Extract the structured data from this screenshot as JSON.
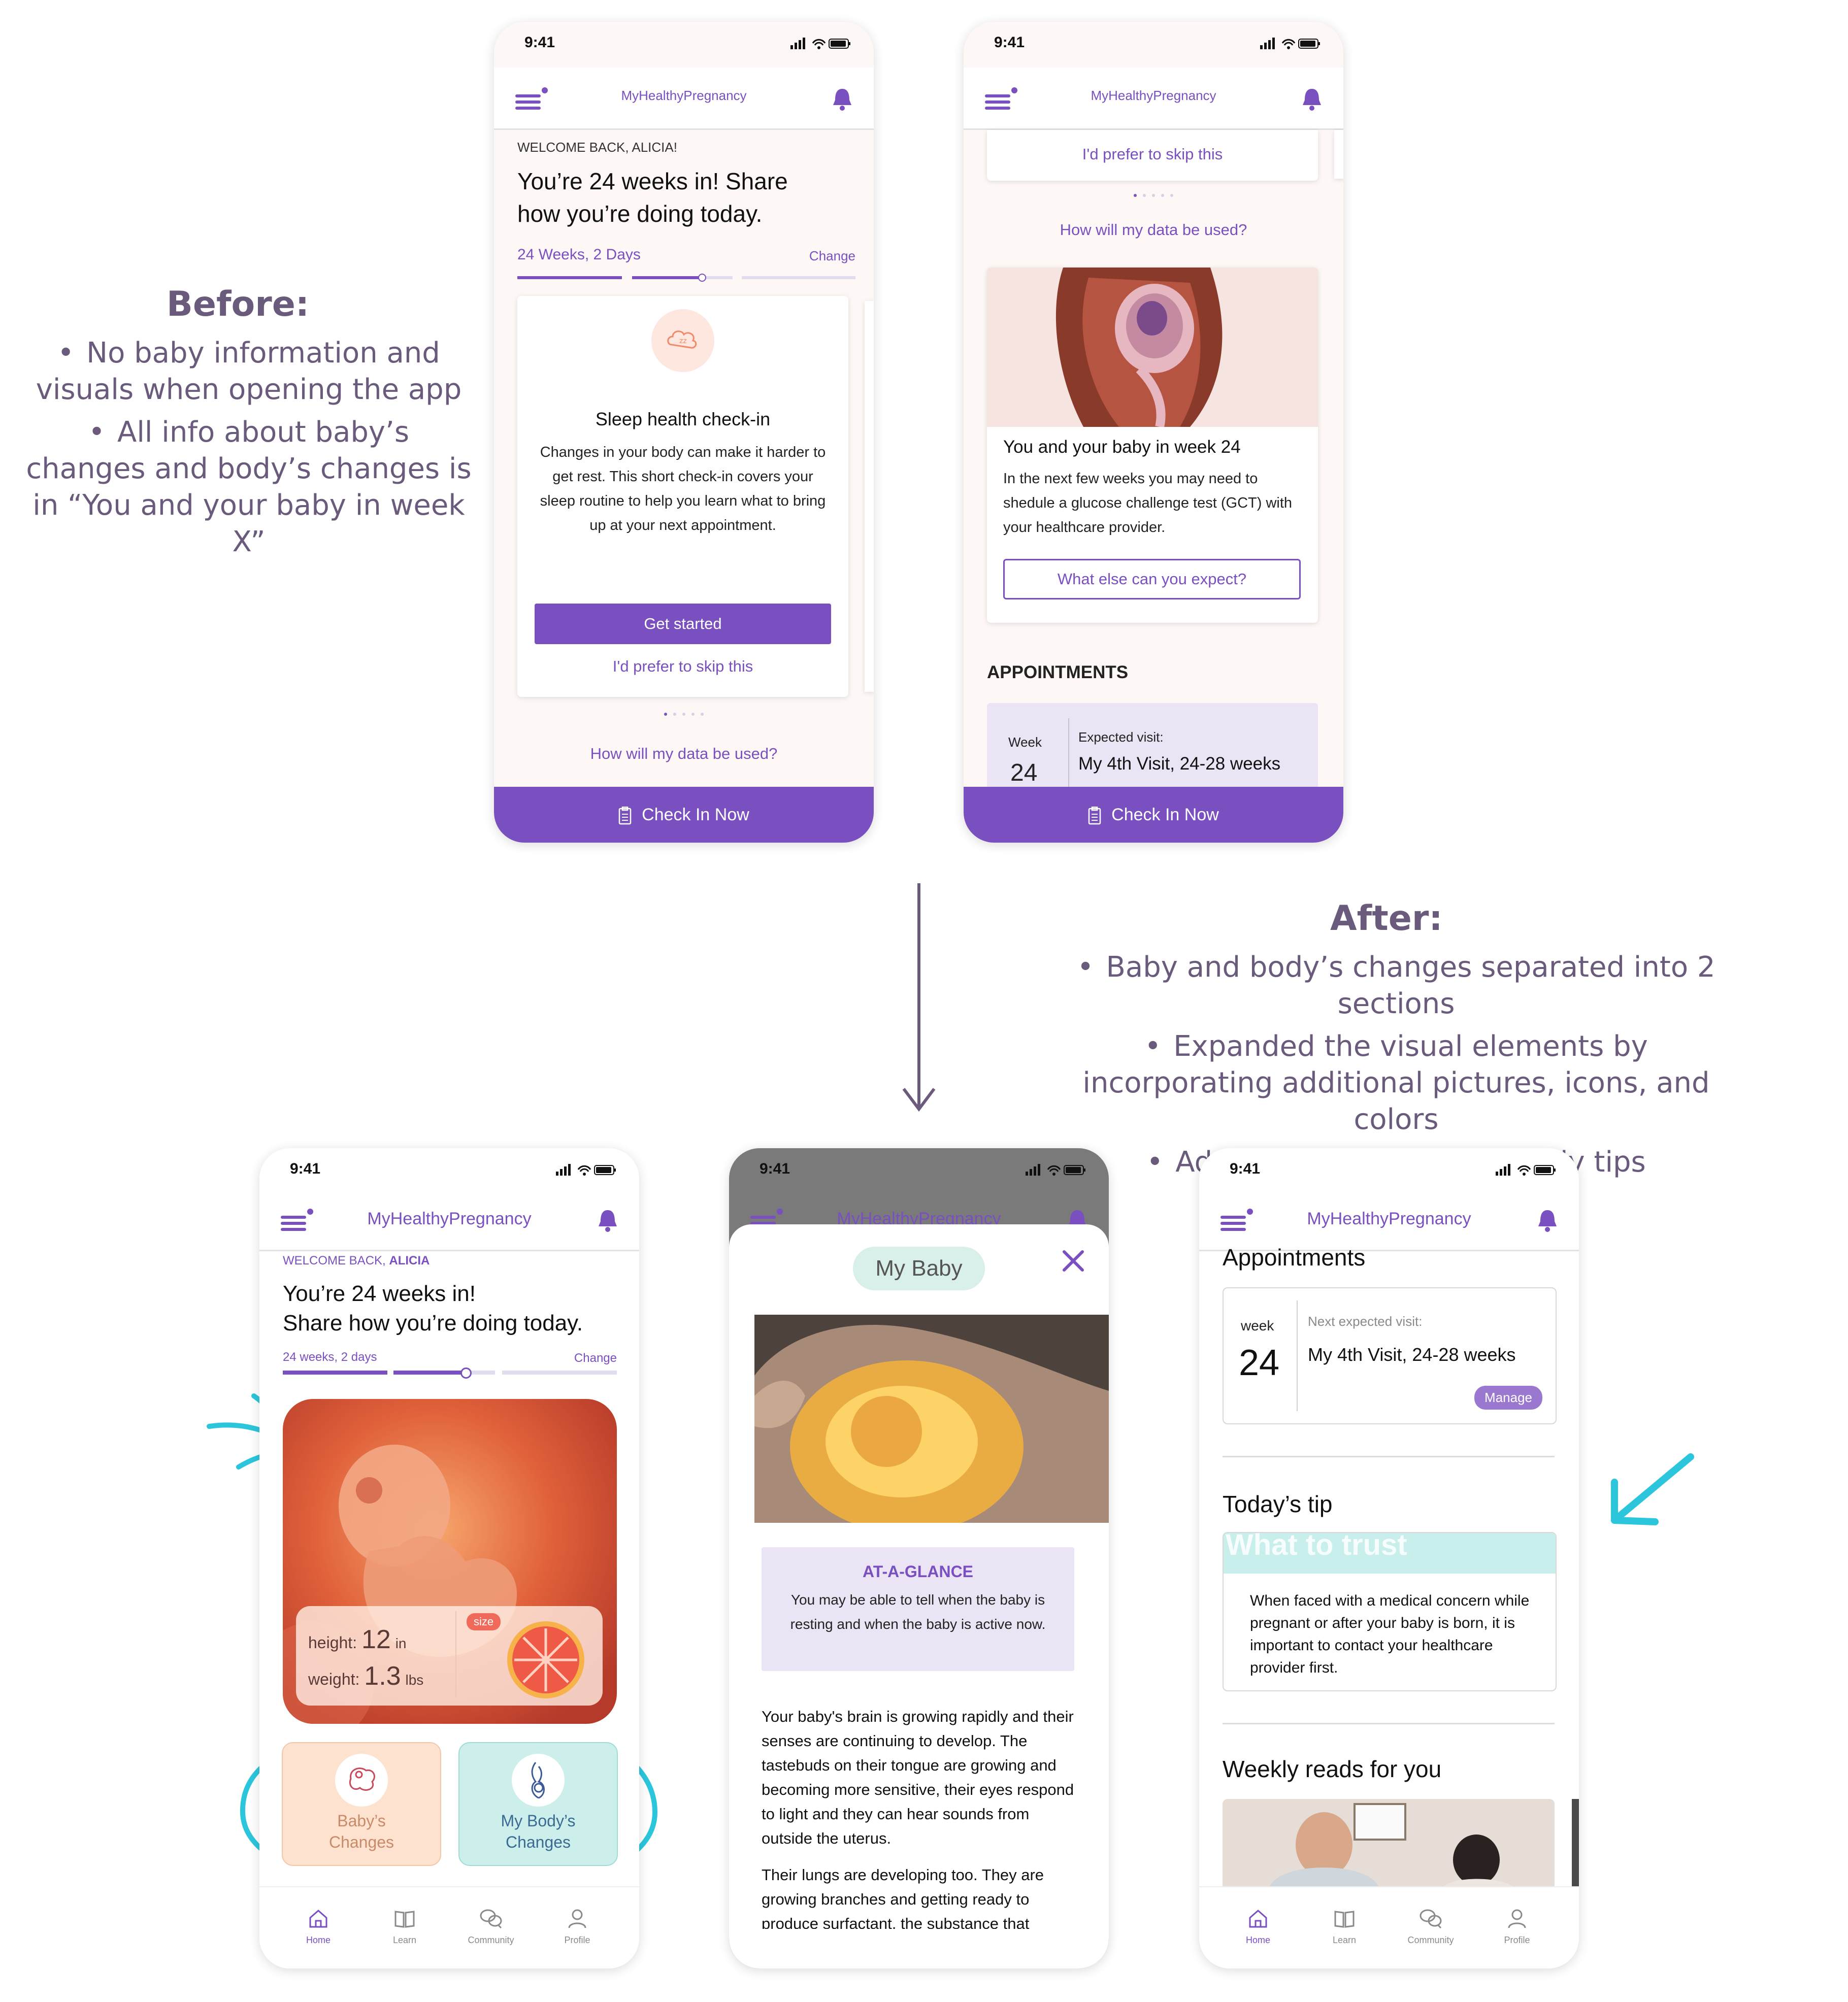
{
  "annotations": {
    "before_title": "Before:",
    "before_bullets": [
      "No baby information and visuals when opening the app",
      "All info about baby’s changes and body’s changes is in “You and your baby in week X”"
    ],
    "after_title": "After:",
    "after_bullets": [
      "Baby and body’s changes separated into 2 sections",
      "Expanded the visual elements by incorporating additional pictures, icons, and colors",
      "Added a size guide and daily tips"
    ]
  },
  "common": {
    "time": "9:41",
    "app_name": "MyHealthyPregnancy",
    "check_in": "Check In Now",
    "accent": "#7a4fc0"
  },
  "before1": {
    "welcome": "WELCOME BACK, ALICIA!",
    "headline": "You’re 24 weeks in! Share how you’re doing today.",
    "weeks": "24 Weeks, 2 Days",
    "change": "Change",
    "card_title": "Sleep health check-in",
    "card_body": "Changes in your body can make it harder to get rest. This short check-in covers your sleep routine to help you learn what to bring up at your next appointment.",
    "get_started": "Get started",
    "skip": "I'd prefer to skip this",
    "data_link": "How will my data be used?"
  },
  "before2": {
    "skip": "I'd prefer to skip this",
    "data_link": "How will my data be used?",
    "baby_title": "You and your baby in week 24",
    "baby_body": "In the next few weeks you may need to shedule a glucose challenge test (GCT) with your healthcare provider.",
    "what_else": "What else can you expect?",
    "appointments": "APPOINTMENTS",
    "week_label": "Week",
    "week_num": "24",
    "expected": "Expected visit:",
    "visit": "My 4th Visit, 24-28 weeks"
  },
  "after1": {
    "welcome_prefix": "WELCOME BACK, ",
    "welcome_name": "ALICIA",
    "headline1": "You’re 24 weeks in!",
    "headline2": "Share how you’re doing today.",
    "weeks": "24 weeks, 2 days",
    "change": "Change",
    "height_label": "height:",
    "height_val": "12",
    "height_unit": "in",
    "weight_label": "weight:",
    "weight_val": "1.3",
    "weight_unit": "lbs",
    "size_badge": "size",
    "baby_changes": "Baby’s Changes",
    "body_changes": "My Body’s Changes"
  },
  "after2": {
    "pill": "My Baby",
    "glance_title": "AT-A-GLANCE",
    "glance_body": "You may be able to tell when the baby is resting and when the baby is active now.",
    "para1": "Your baby's brain is growing rapidly and their senses are continuing to develop. The tastebuds on their tongue are growing and becoming more sensitive, their eyes respond to light and they can hear sounds from outside the uterus.",
    "para2": "Their lungs are developing too. They are growing branches and getting ready to produce surfactant, the substance that"
  },
  "after3": {
    "appointments": "Appointments",
    "week_label": "week",
    "week_num": "24",
    "next_visit": "Next expected visit:",
    "visit": "My 4th Visit, 24-28 weeks",
    "manage": "Manage",
    "tip_heading": "Today’s tip",
    "tip_title": "What to trust",
    "tip_body": "When faced with a medical concern while pregnant or after your baby is born, it is important to contact your healthcare provider first.",
    "weekly": "Weekly reads for you"
  },
  "tabs": [
    "Home",
    "Learn",
    "Community",
    "Profile"
  ]
}
